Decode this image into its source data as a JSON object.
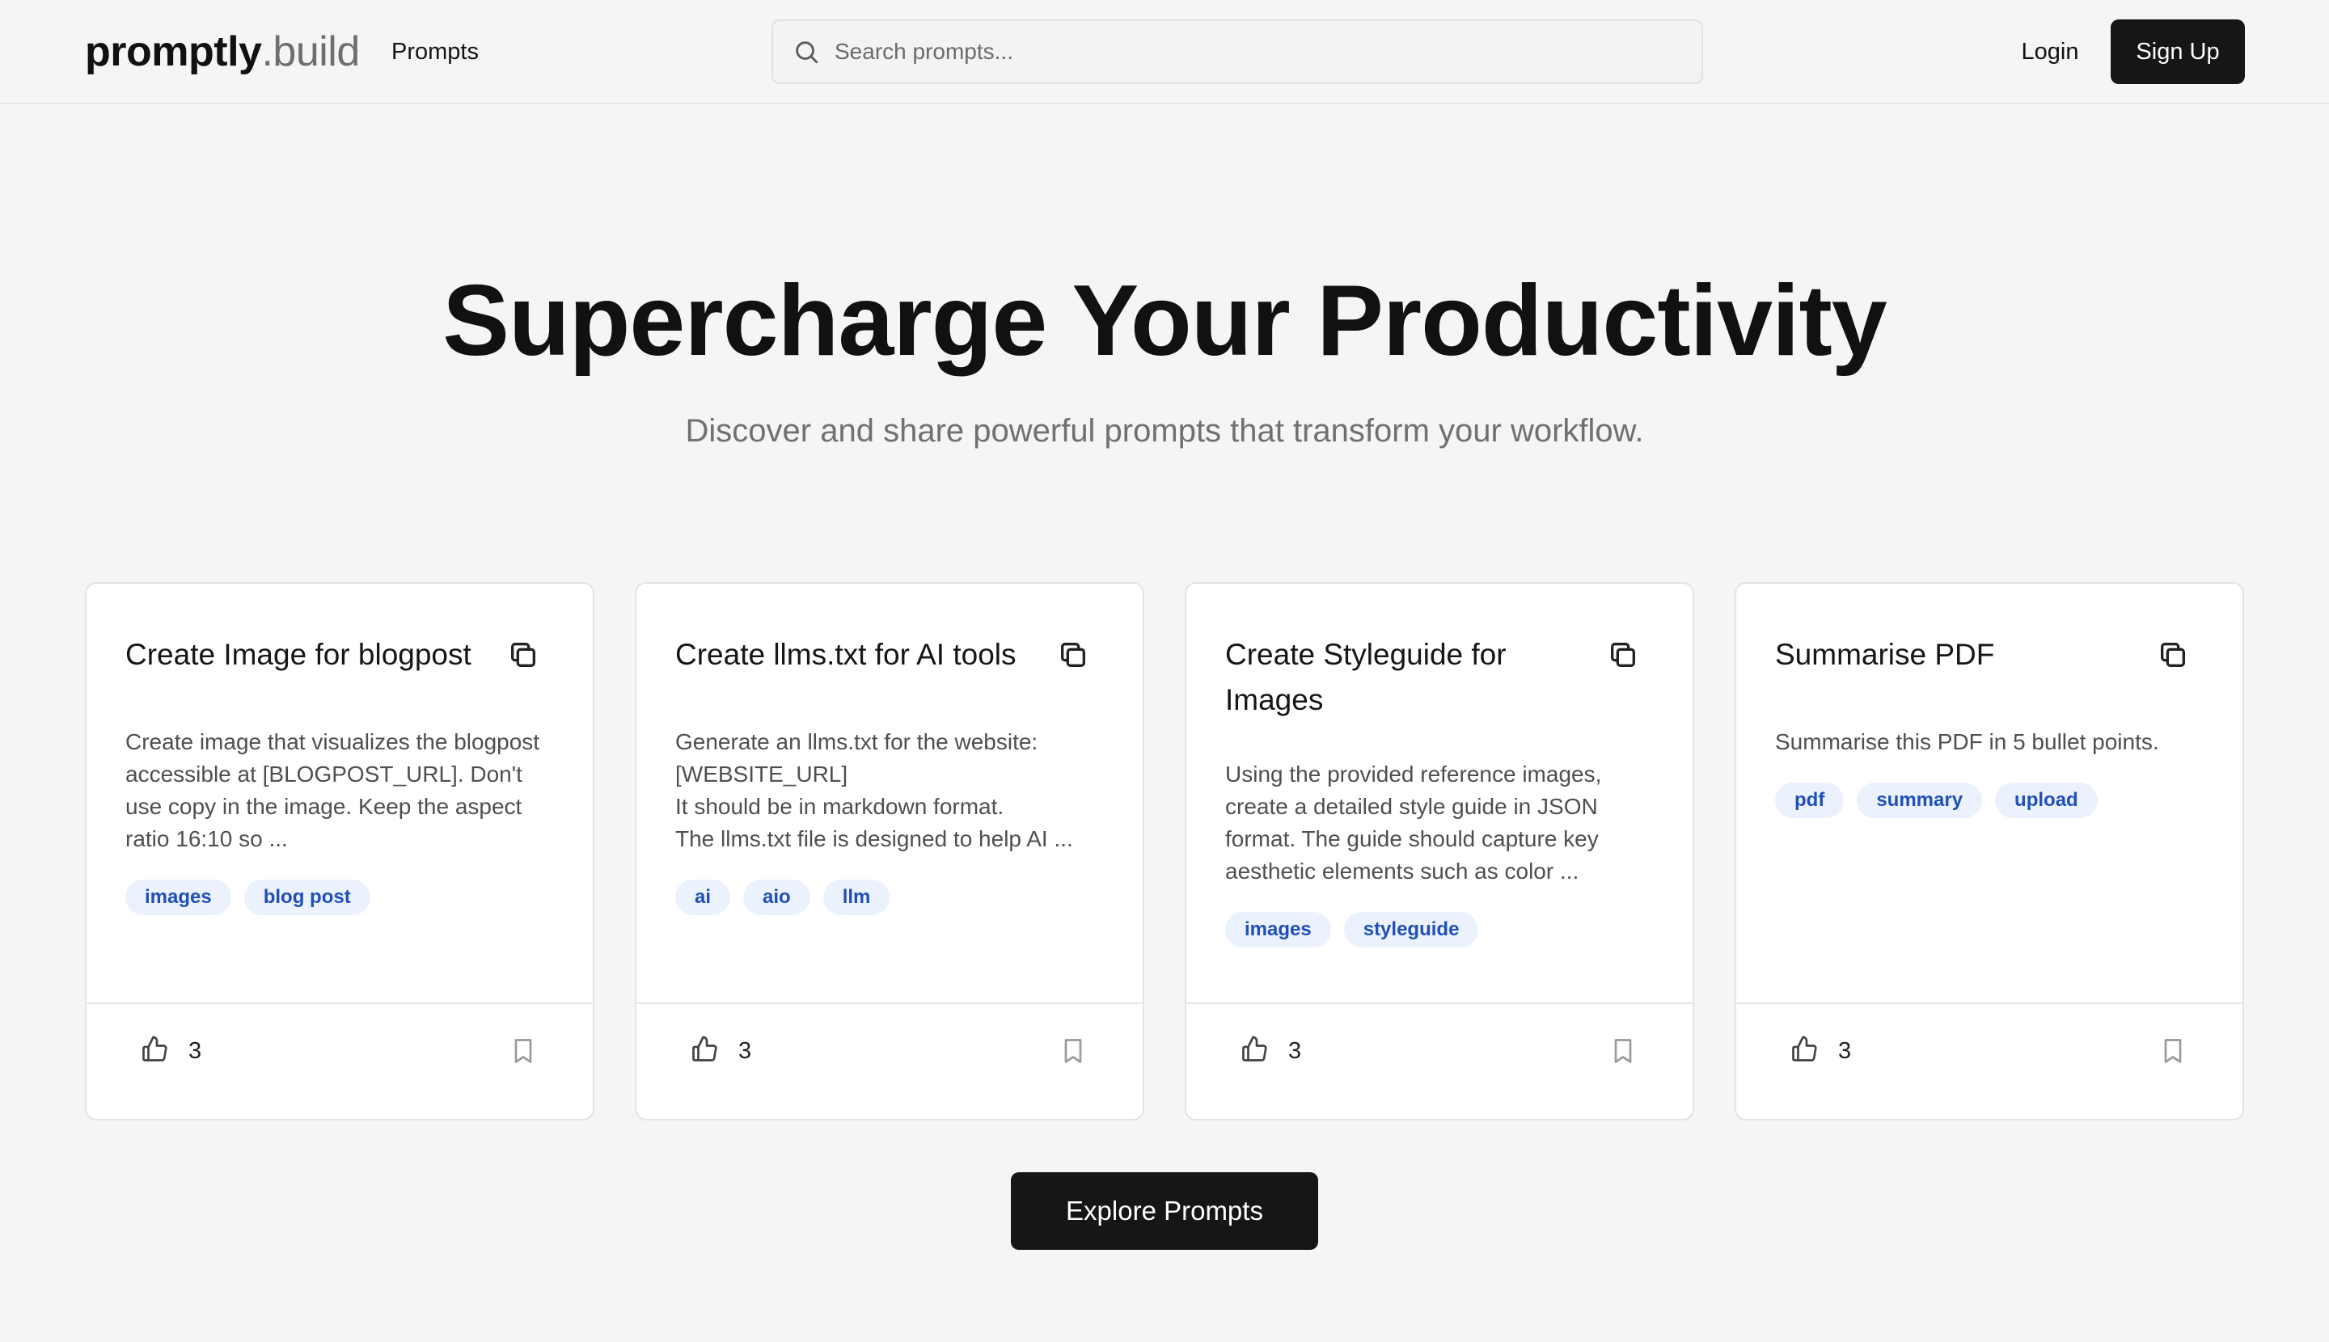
{
  "header": {
    "logo_bold": "promptly",
    "logo_light": ".build",
    "nav_prompts": "Prompts",
    "search_placeholder": "Search prompts...",
    "login": "Login",
    "signup": "Sign Up"
  },
  "hero": {
    "title": "Supercharge Your Productivity",
    "subtitle": "Discover and share powerful prompts that transform your workflow."
  },
  "cards": [
    {
      "title": "Create Image for blogpost",
      "description": "Create image that visualizes the blogpost accessible at [BLOGPOST_URL]. Don't use copy in the image. Keep the aspect ratio 16:10 so ...",
      "tags": [
        "images",
        "blog post"
      ],
      "likes": "3"
    },
    {
      "title": "Create llms.txt for AI tools",
      "description": "Generate an llms.txt for the website:\n[WEBSITE_URL]\nIt should be in markdown format.\nThe llms.txt file is designed to help AI ...",
      "tags": [
        "ai",
        "aio",
        "llm"
      ],
      "likes": "3"
    },
    {
      "title": "Create Styleguide for Images",
      "description": "Using the provided reference images, create a detailed style guide in JSON format. The guide should capture key aesthetic elements such as color ...",
      "tags": [
        "images",
        "styleguide"
      ],
      "likes": "3"
    },
    {
      "title": "Summarise PDF",
      "description": "Summarise this PDF in 5 bullet points.",
      "tags": [
        "pdf",
        "summary",
        "upload"
      ],
      "likes": "3"
    }
  ],
  "explore_button": "Explore Prompts"
}
